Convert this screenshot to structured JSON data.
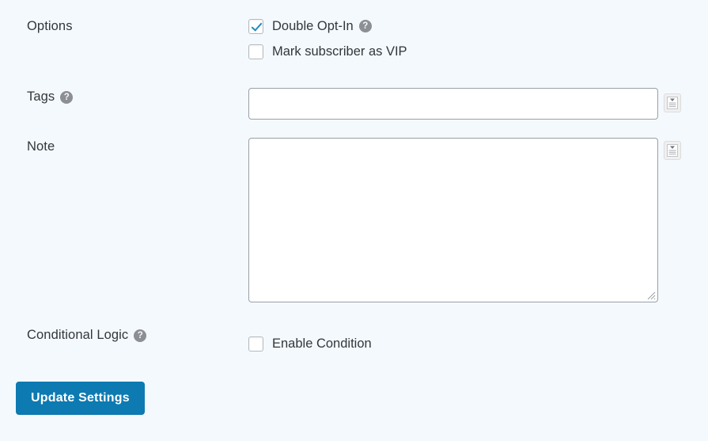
{
  "form": {
    "rows": [
      {
        "label": "Options",
        "has_help": false,
        "checkboxes": [
          {
            "label": "Double Opt-In",
            "checked": true,
            "has_help": true
          },
          {
            "label": "Mark subscriber as VIP",
            "checked": false,
            "has_help": false
          }
        ]
      },
      {
        "label": "Tags",
        "has_help": true,
        "input": {
          "value": "",
          "placeholder": ""
        },
        "smartcode_button": "smartcode-icon"
      },
      {
        "label": "Note",
        "has_help": false,
        "textarea": {
          "value": "",
          "placeholder": ""
        },
        "smartcode_button": "smartcode-icon"
      },
      {
        "label": "Conditional Logic",
        "has_help": true,
        "checkboxes": [
          {
            "label": "Enable Condition",
            "checked": false,
            "has_help": false
          }
        ]
      }
    ],
    "submit_label": "Update Settings"
  },
  "colors": {
    "background": "#f4f9fd",
    "accent": "#0d7ab2",
    "check_blue": "#1e8cbe",
    "label_text": "#32373c",
    "border": "#9aa0a6",
    "help_gray": "#8c8f94"
  }
}
